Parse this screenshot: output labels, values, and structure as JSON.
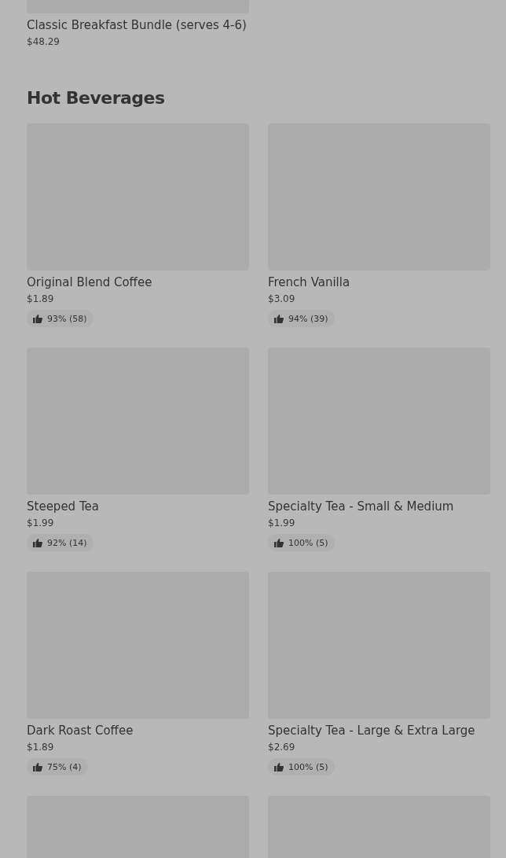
{
  "previous_item": {
    "image": {
      "kind": "picture"
    },
    "name": "Classic Breakfast Bundle (serves 4-6)",
    "price": "$48.29"
  },
  "section": {
    "title": "Hot Beverages",
    "items": [
      {
        "kind": "product",
        "name": "Original Blend Coffee",
        "price": "$1.89",
        "rating": "93% (58)"
      },
      {
        "kind": "product",
        "name": "French Vanilla",
        "price": "$3.09",
        "rating": "94% (39)"
      },
      {
        "kind": "product",
        "name": "Steeped Tea",
        "price": "$1.99",
        "rating": "92% (14)"
      },
      {
        "kind": "product",
        "name": "Specialty Tea - Small & Medium",
        "price": "$1.99",
        "rating": "100% (5)"
      },
      {
        "kind": "product",
        "name": "Dark Roast Coffee",
        "price": "$1.89",
        "rating": "75% (4)"
      },
      {
        "kind": "product",
        "name": "Specialty Tea - Large & Extra Large",
        "price": "$2.69",
        "rating": "100% (5)"
      },
      {
        "kind": "picture"
      },
      {
        "kind": "picture"
      }
    ]
  }
}
